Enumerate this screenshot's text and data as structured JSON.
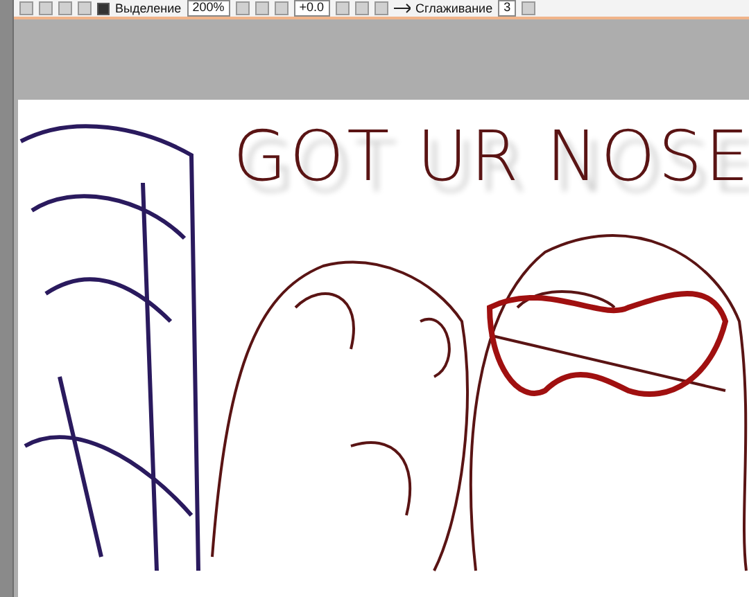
{
  "toolbar": {
    "selection_checkbox": {
      "label": "Выделение",
      "checked": true
    },
    "zoom": {
      "value": "200%"
    },
    "rotation": {
      "value": "+0.0"
    },
    "smoothing": {
      "label": "Сглаживание",
      "value": "3"
    }
  },
  "canvas": {
    "lettering": "GOT UR NOSE"
  }
}
